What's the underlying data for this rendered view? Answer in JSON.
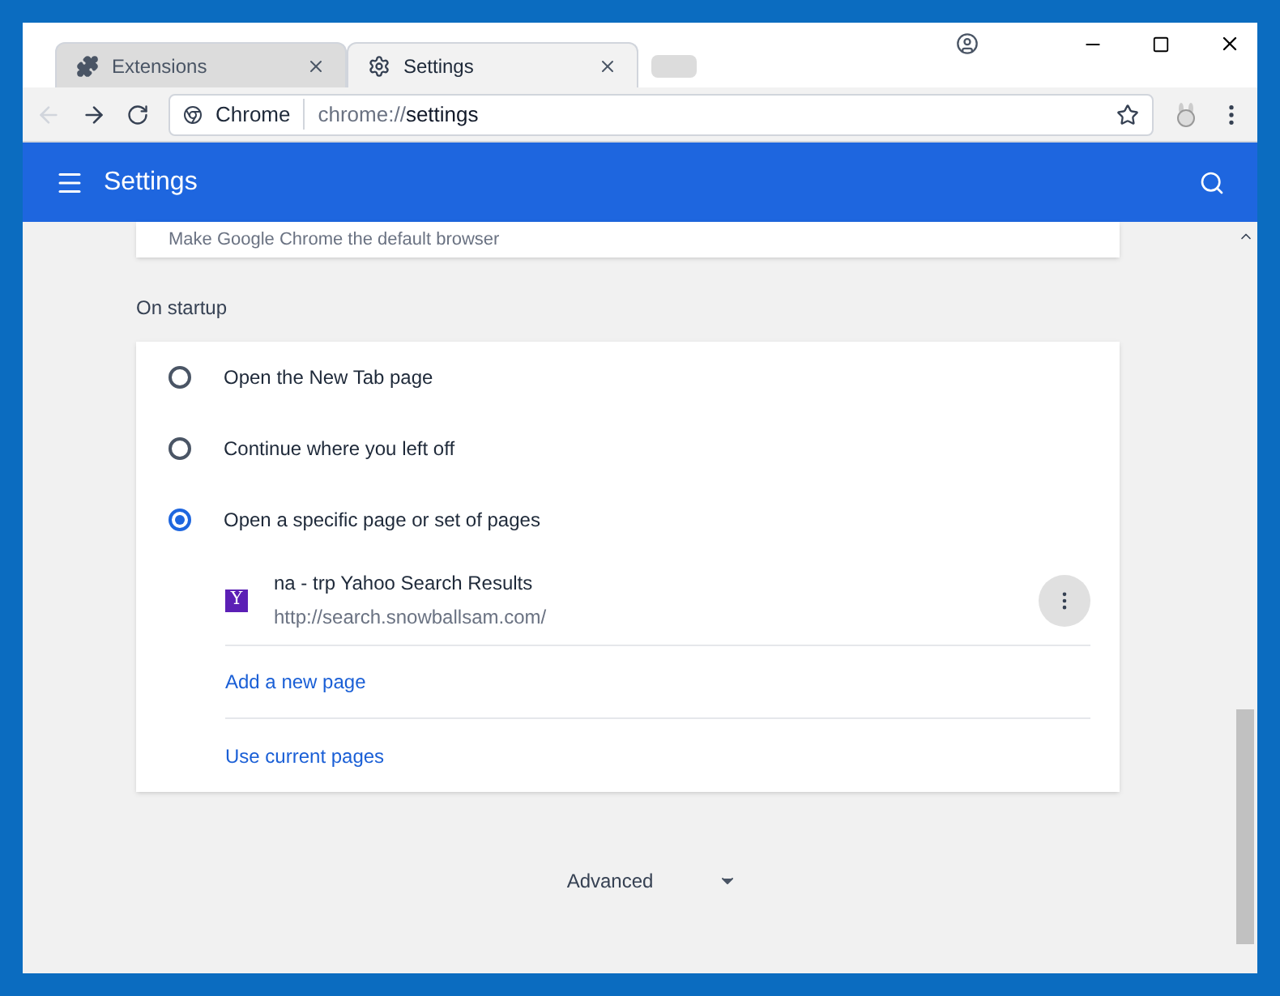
{
  "tabs": [
    {
      "label": "Extensions",
      "kind": "extensions",
      "selected": false
    },
    {
      "label": "Settings",
      "kind": "settings",
      "selected": true
    }
  ],
  "omnibox": {
    "site": "Chrome",
    "url_prefix": "chrome://",
    "url_host": "settings"
  },
  "header": {
    "title": "Settings"
  },
  "default_browser": {
    "text": "Make Google Chrome the default browser"
  },
  "startup": {
    "heading": "On startup",
    "options": [
      {
        "label": "Open the New Tab page",
        "selected": false
      },
      {
        "label": "Continue where you left off",
        "selected": false
      },
      {
        "label": "Open a specific page or set of pages",
        "selected": true
      }
    ],
    "pages": [
      {
        "favicon": "Y",
        "title": "na - trp Yahoo Search Results",
        "url": "http://search.snowballsam.com/"
      }
    ],
    "links": [
      "Add a new page",
      "Use current pages"
    ]
  },
  "advanced": {
    "label": "Advanced"
  }
}
